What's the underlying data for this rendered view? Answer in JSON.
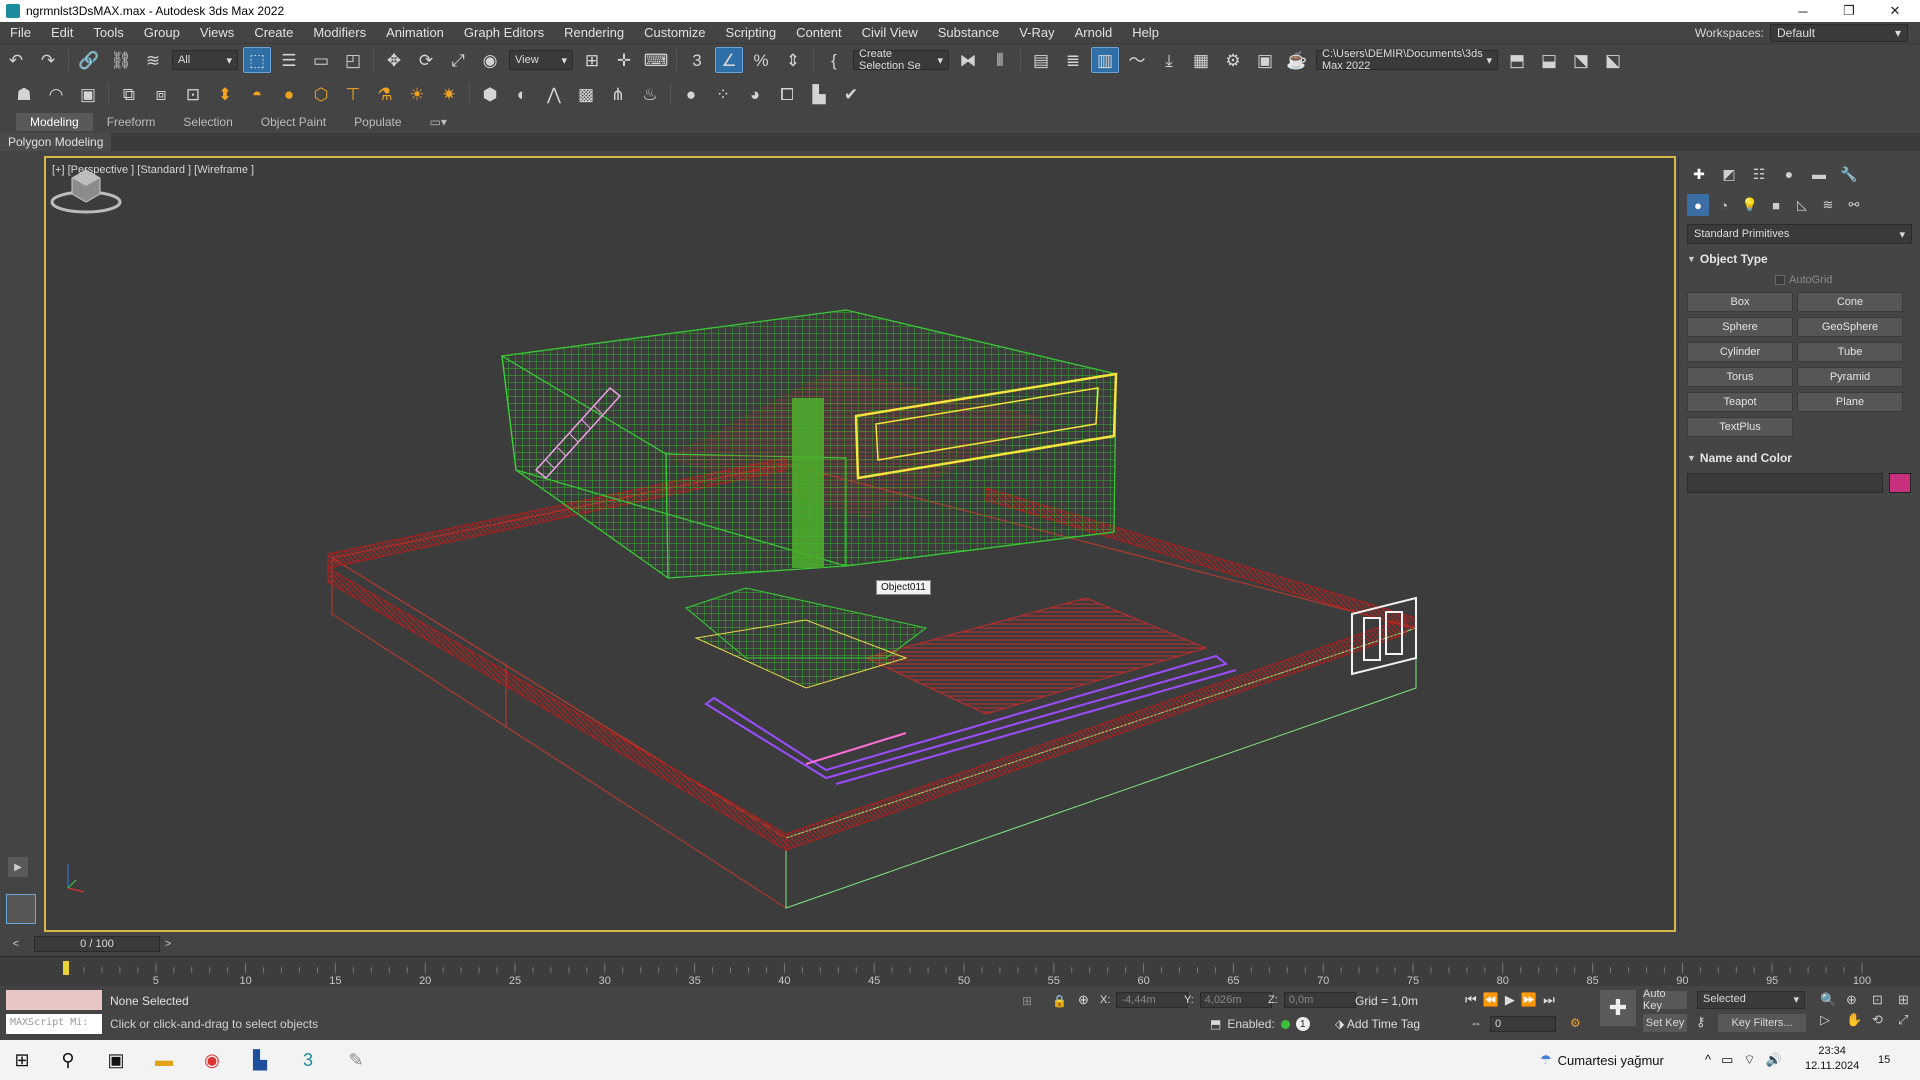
{
  "window": {
    "title": "ngrmnlst3DsMAX.max - Autodesk 3ds Max 2022",
    "minimize": "─",
    "maximize": "❐",
    "close": "✕"
  },
  "menu": [
    "File",
    "Edit",
    "Tools",
    "Group",
    "Views",
    "Create",
    "Modifiers",
    "Animation",
    "Graph Editors",
    "Rendering",
    "Customize",
    "Scripting",
    "Content",
    "Civil View",
    "Substance",
    "V-Ray",
    "Arnold",
    "Help"
  ],
  "workspace": {
    "label": "Workspaces:",
    "value": "Default"
  },
  "toolbar1": {
    "filter": "All",
    "ref_coord": "View",
    "selection_set": "Create Selection Se",
    "path": "C:\\Users\\DEMIR\\Documents\\3ds Max 2022"
  },
  "ribbon": {
    "tabs": [
      "Modeling",
      "Freeform",
      "Selection",
      "Object Paint",
      "Populate"
    ],
    "active": "Modeling",
    "sub": "Polygon Modeling"
  },
  "viewport": {
    "label": "[+] [Perspective ] [Standard ] [Wireframe ]",
    "tooltip": "Object011"
  },
  "command_panel": {
    "category": "Standard Primitives",
    "object_type_title": "Object Type",
    "autogrid": "AutoGrid",
    "primitives": [
      "Box",
      "Cone",
      "Sphere",
      "GeoSphere",
      "Cylinder",
      "Tube",
      "Torus",
      "Pyramid",
      "Teapot",
      "Plane",
      "TextPlus"
    ],
    "name_color_title": "Name and Color",
    "color": "#c8307d"
  },
  "timeline": {
    "frame": "0 / 100",
    "ticks": [
      "5",
      "10",
      "15",
      "20",
      "25",
      "30",
      "35",
      "40",
      "45",
      "50",
      "55",
      "60",
      "65",
      "70",
      "75",
      "80",
      "85",
      "90",
      "95",
      "100"
    ]
  },
  "status": {
    "maxscript": "MAXScript Mi:",
    "selection": "None Selected",
    "prompt": "Click or click-and-drag to select objects",
    "x_label": "X:",
    "x": "-4,44m",
    "y_label": "Y:",
    "y": "4,026m",
    "z_label": "Z:",
    "z": "0,0m",
    "grid": "Grid = 1,0m",
    "enabled": "Enabled:",
    "enabled_count": "1",
    "add_time_tag": "Add Time Tag",
    "frame_value": "0",
    "auto_key": "Auto Key",
    "set_key": "Set Key",
    "selected": "Selected",
    "key_filters": "Key Filters..."
  },
  "taskbar": {
    "weather": "Cumartesi yağmur",
    "time": "23:34",
    "date": "12.11.2024",
    "notif_count": "15"
  }
}
